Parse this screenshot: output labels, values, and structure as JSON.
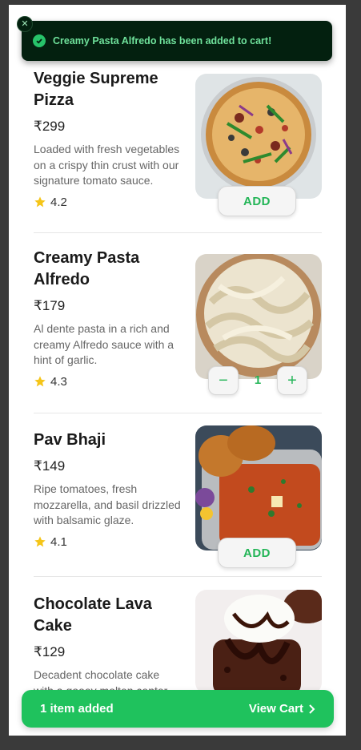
{
  "toast": {
    "message": "Creamy Pasta Alfredo has been added to cart!",
    "close_icon": "close-icon",
    "check_icon": "check-circle-icon"
  },
  "items": [
    {
      "name": "Veggie Supreme Pizza",
      "price": "₹299",
      "description": "Loaded with fresh vegetables on a crispy thin crust with our signature tomato sauce.",
      "rating": "4.2",
      "action": "ADD"
    },
    {
      "name": "Creamy Pasta Alfredo",
      "price": "₹179",
      "description": "Al dente pasta in a rich and creamy Alfredo sauce with a hint of garlic.",
      "rating": "4.3",
      "quantity": "1",
      "minus": "−",
      "plus": "+"
    },
    {
      "name": "Pav Bhaji",
      "price": "₹149",
      "description": "Ripe tomatoes, fresh mozzarella, and basil drizzled with balsamic glaze.",
      "rating": "4.1",
      "action": "ADD"
    },
    {
      "name": "Chocolate Lava Cake",
      "price": "₹129",
      "description": "Decadent chocolate cake with a gooey molten center, served warm."
    }
  ],
  "cart_bar": {
    "count_label": "1 item added",
    "view_label": "View Cart",
    "chevron_icon": "chevron-right-icon"
  },
  "colors": {
    "accent": "#1fc25d",
    "toast_bg": "#03200f",
    "star": "#f5c518"
  }
}
